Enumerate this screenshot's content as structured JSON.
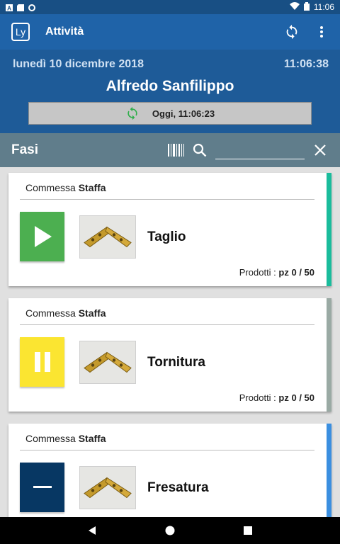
{
  "statusbar": {
    "clock": "11:06",
    "icons": [
      "a-notification-icon",
      "sd-card-icon",
      "circle-icon",
      "wifi-icon",
      "battery-icon"
    ]
  },
  "appbar": {
    "logo": "Ly",
    "title": "Attività"
  },
  "info": {
    "date": "lunedì 10 dicembre 2018",
    "time": "11:06:38",
    "user": "Alfredo Sanfilippo",
    "sync_label": "Oggi, 11:06:23"
  },
  "phases_bar": {
    "title": "Fasi",
    "search_value": ""
  },
  "cards": [
    {
      "order_prefix": "Commessa",
      "order_name": "Staffa",
      "phase": "Taglio",
      "products_label": "Prodotti :",
      "products_value": "pz 0 / 50",
      "status": "play",
      "status_color": "#4caf50",
      "stripe_color": "#1abc9c"
    },
    {
      "order_prefix": "Commessa",
      "order_name": "Staffa",
      "phase": "Tornitura",
      "products_label": "Prodotti :",
      "products_value": "pz 0 / 50",
      "status": "pause",
      "status_color": "#fbe531",
      "stripe_color": "#9aaaa4"
    },
    {
      "order_prefix": "Commessa",
      "order_name": "Staffa",
      "phase": "Fresatura",
      "products_label": "",
      "products_value": "",
      "status": "stop",
      "status_color": "#073763",
      "stripe_color": "#3b8fe0"
    }
  ],
  "colors": {
    "appbar": "#1f63a8",
    "info_panel": "#1e5b98",
    "phases_bar": "#607d8b",
    "sync_icon": "#2eae4a"
  }
}
